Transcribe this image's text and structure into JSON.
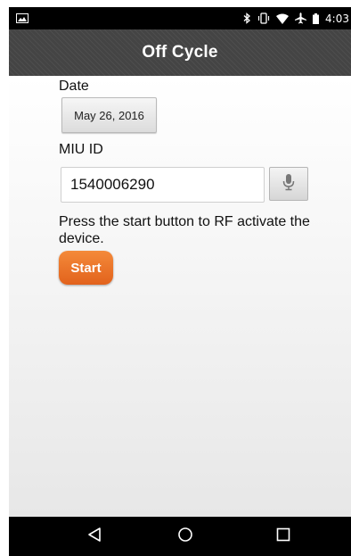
{
  "status_bar": {
    "time": "4:03",
    "icons": [
      "image-notification-icon",
      "bluetooth-icon",
      "vibrate-icon",
      "wifi-icon",
      "airplane-mode-icon",
      "battery-icon"
    ]
  },
  "app_bar": {
    "title": "Off Cycle"
  },
  "form": {
    "date_label": "Date",
    "date_value": "May 26, 2016",
    "miu_label": "MIU ID",
    "miu_value": "1540006290",
    "instruction": "Press the start button to RF activate the device.",
    "start_label": "Start"
  },
  "nav_bar": {
    "buttons": [
      "back-icon",
      "home-icon",
      "recents-icon"
    ]
  },
  "colors": {
    "accent": "#e8712a",
    "app_bar": "#444444",
    "system_bar": "#000000"
  }
}
